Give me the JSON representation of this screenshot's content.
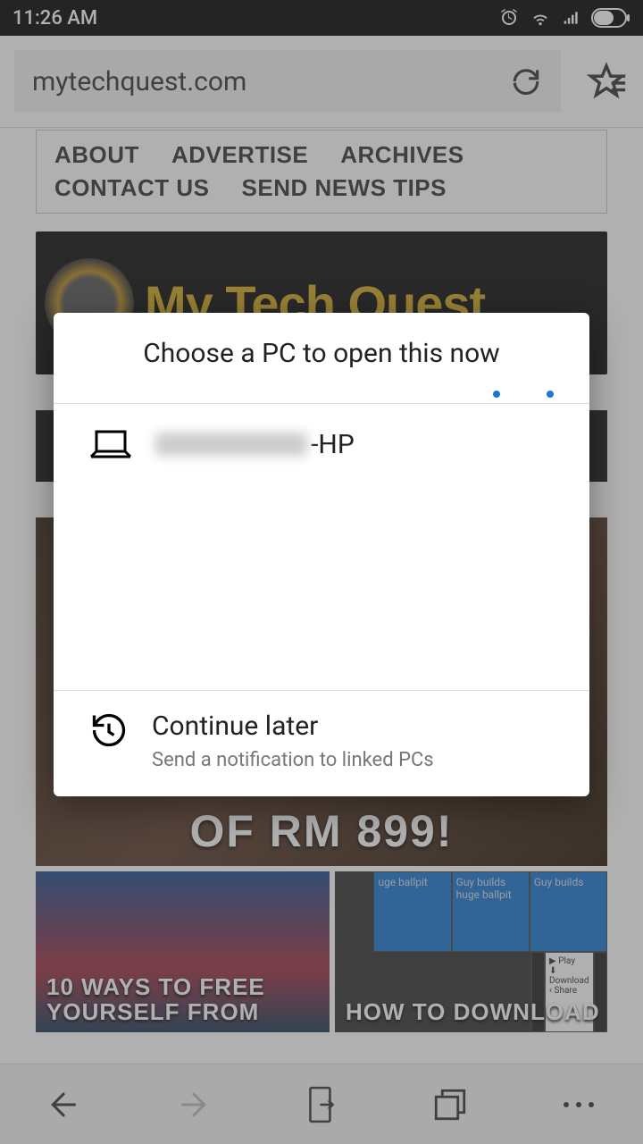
{
  "status": {
    "time": "11:26 AM"
  },
  "address": {
    "url": "mytechquest.com"
  },
  "nav": {
    "items": [
      "ABOUT",
      "ADVERTISE",
      "ARCHIVES",
      "CONTACT US",
      "SEND NEWS TIPS"
    ]
  },
  "hero": {
    "brand": "My Tech Quest"
  },
  "feature": {
    "headline_tail": "OF RM 899!"
  },
  "cards": {
    "a_title": "10 WAYS TO FREE YOURSELF FROM",
    "b_title": "HOW TO DOWNLOAD",
    "b_cells": [
      "uge ballpit",
      "Guy builds huge ballpit",
      "Guy builds"
    ],
    "b_menu": [
      "Play",
      "Download",
      "Share"
    ]
  },
  "modal": {
    "title": "Choose a PC to open this now",
    "pc_suffix": "-HP",
    "later_title": "Continue later",
    "later_sub": "Send a notification to linked PCs"
  }
}
